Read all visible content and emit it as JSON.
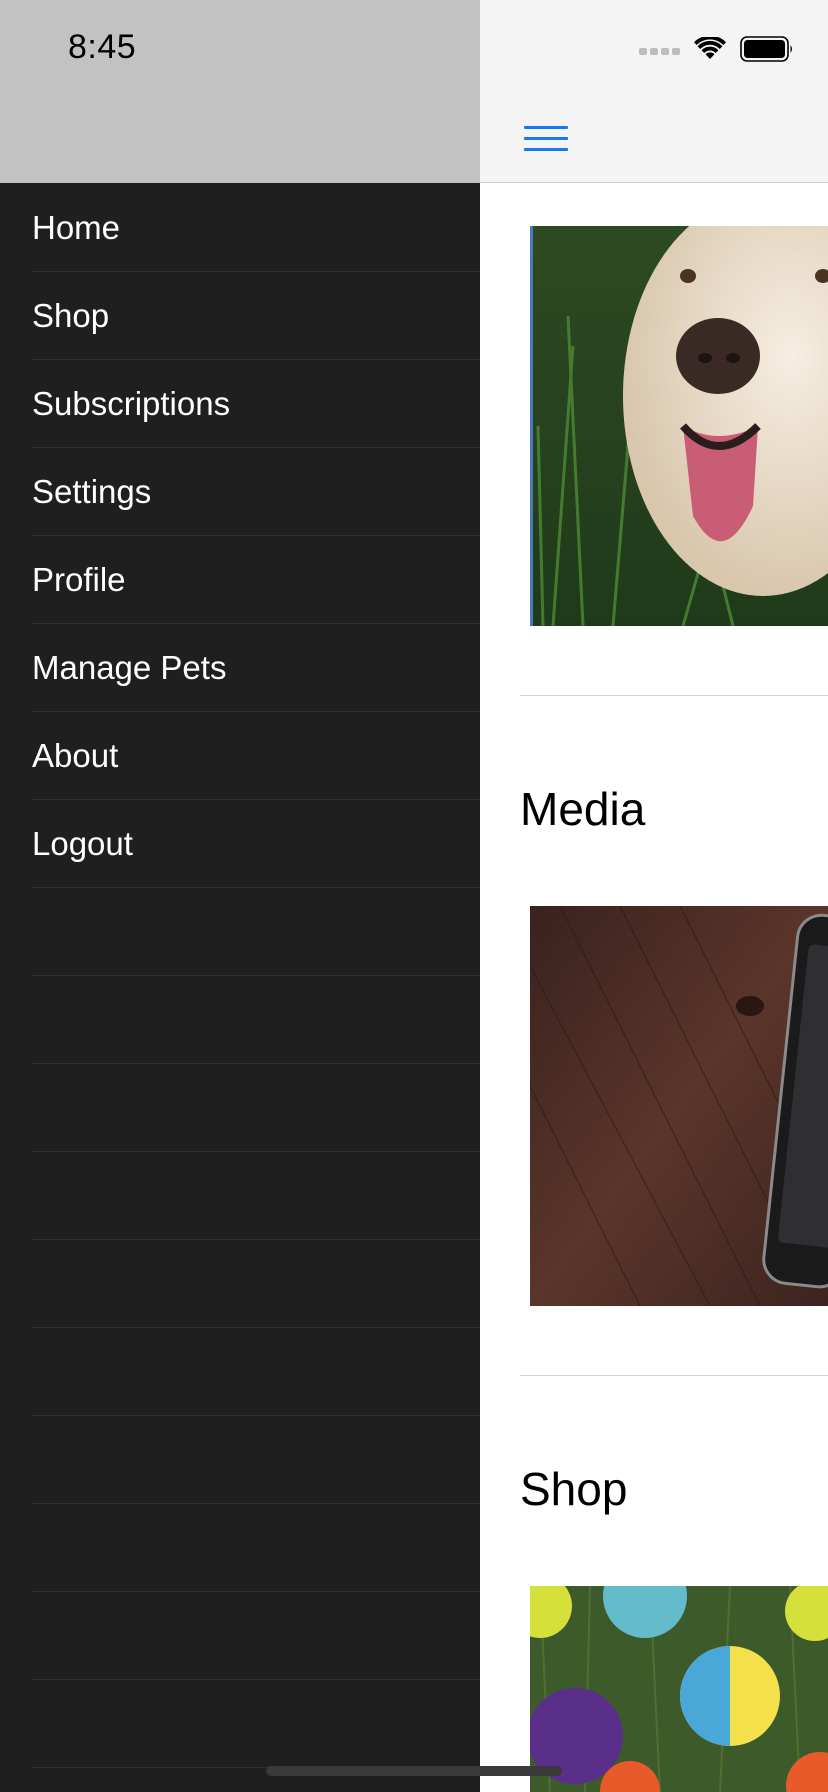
{
  "status_bar": {
    "time": "8:45"
  },
  "menu": {
    "items": [
      {
        "label": "Home"
      },
      {
        "label": "Shop"
      },
      {
        "label": "Subscriptions"
      },
      {
        "label": "Settings"
      },
      {
        "label": "Profile"
      },
      {
        "label": "Manage Pets"
      },
      {
        "label": "About"
      },
      {
        "label": "Logout"
      }
    ]
  },
  "navbar": {
    "menu_icon": "hamburger-menu-icon"
  },
  "content": {
    "sections": [
      {
        "title": ""
      },
      {
        "title": "Media"
      },
      {
        "title": "Shop"
      }
    ]
  },
  "colors": {
    "menu_background": "#1f1f1f",
    "menu_status_background": "#c2c2c2",
    "accent": "#1877f2",
    "navbar_background": "#f5f4f5"
  }
}
